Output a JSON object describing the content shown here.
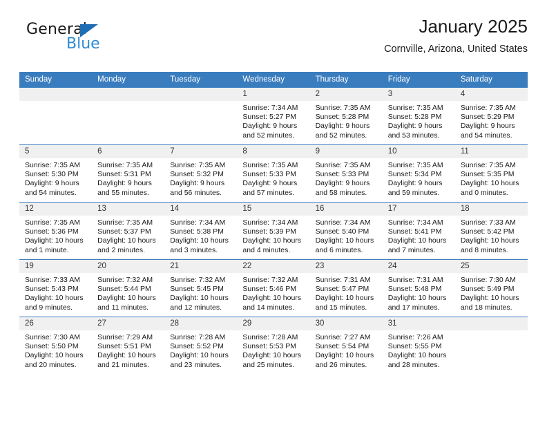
{
  "brand": {
    "name_top": "General",
    "name_bottom": "Blue",
    "accent_color": "#2e8bd4",
    "triangle_color": "#1f6db4"
  },
  "header": {
    "title": "January 2025",
    "subtitle": "Cornville, Arizona, United States"
  },
  "theme": {
    "header_bg": "#3a7dbf",
    "daynum_bg": "#f0f0f0",
    "page_bg": "#ffffff"
  },
  "weekday_headers": [
    "Sunday",
    "Monday",
    "Tuesday",
    "Wednesday",
    "Thursday",
    "Friday",
    "Saturday"
  ],
  "labels": {
    "sunrise_prefix": "Sunrise:",
    "sunset_prefix": "Sunset:",
    "daylight_prefix": "Daylight:"
  },
  "weeks": [
    [
      {
        "day": "",
        "sunrise": "",
        "sunset": "",
        "daylight_line1": "",
        "daylight_line2": ""
      },
      {
        "day": "",
        "sunrise": "",
        "sunset": "",
        "daylight_line1": "",
        "daylight_line2": ""
      },
      {
        "day": "",
        "sunrise": "",
        "sunset": "",
        "daylight_line1": "",
        "daylight_line2": ""
      },
      {
        "day": "1",
        "sunrise": "Sunrise: 7:34 AM",
        "sunset": "Sunset: 5:27 PM",
        "daylight_line1": "Daylight: 9 hours",
        "daylight_line2": "and 52 minutes."
      },
      {
        "day": "2",
        "sunrise": "Sunrise: 7:35 AM",
        "sunset": "Sunset: 5:28 PM",
        "daylight_line1": "Daylight: 9 hours",
        "daylight_line2": "and 52 minutes."
      },
      {
        "day": "3",
        "sunrise": "Sunrise: 7:35 AM",
        "sunset": "Sunset: 5:28 PM",
        "daylight_line1": "Daylight: 9 hours",
        "daylight_line2": "and 53 minutes."
      },
      {
        "day": "4",
        "sunrise": "Sunrise: 7:35 AM",
        "sunset": "Sunset: 5:29 PM",
        "daylight_line1": "Daylight: 9 hours",
        "daylight_line2": "and 54 minutes."
      }
    ],
    [
      {
        "day": "5",
        "sunrise": "Sunrise: 7:35 AM",
        "sunset": "Sunset: 5:30 PM",
        "daylight_line1": "Daylight: 9 hours",
        "daylight_line2": "and 54 minutes."
      },
      {
        "day": "6",
        "sunrise": "Sunrise: 7:35 AM",
        "sunset": "Sunset: 5:31 PM",
        "daylight_line1": "Daylight: 9 hours",
        "daylight_line2": "and 55 minutes."
      },
      {
        "day": "7",
        "sunrise": "Sunrise: 7:35 AM",
        "sunset": "Sunset: 5:32 PM",
        "daylight_line1": "Daylight: 9 hours",
        "daylight_line2": "and 56 minutes."
      },
      {
        "day": "8",
        "sunrise": "Sunrise: 7:35 AM",
        "sunset": "Sunset: 5:33 PM",
        "daylight_line1": "Daylight: 9 hours",
        "daylight_line2": "and 57 minutes."
      },
      {
        "day": "9",
        "sunrise": "Sunrise: 7:35 AM",
        "sunset": "Sunset: 5:33 PM",
        "daylight_line1": "Daylight: 9 hours",
        "daylight_line2": "and 58 minutes."
      },
      {
        "day": "10",
        "sunrise": "Sunrise: 7:35 AM",
        "sunset": "Sunset: 5:34 PM",
        "daylight_line1": "Daylight: 9 hours",
        "daylight_line2": "and 59 minutes."
      },
      {
        "day": "11",
        "sunrise": "Sunrise: 7:35 AM",
        "sunset": "Sunset: 5:35 PM",
        "daylight_line1": "Daylight: 10 hours",
        "daylight_line2": "and 0 minutes."
      }
    ],
    [
      {
        "day": "12",
        "sunrise": "Sunrise: 7:35 AM",
        "sunset": "Sunset: 5:36 PM",
        "daylight_line1": "Daylight: 10 hours",
        "daylight_line2": "and 1 minute."
      },
      {
        "day": "13",
        "sunrise": "Sunrise: 7:35 AM",
        "sunset": "Sunset: 5:37 PM",
        "daylight_line1": "Daylight: 10 hours",
        "daylight_line2": "and 2 minutes."
      },
      {
        "day": "14",
        "sunrise": "Sunrise: 7:34 AM",
        "sunset": "Sunset: 5:38 PM",
        "daylight_line1": "Daylight: 10 hours",
        "daylight_line2": "and 3 minutes."
      },
      {
        "day": "15",
        "sunrise": "Sunrise: 7:34 AM",
        "sunset": "Sunset: 5:39 PM",
        "daylight_line1": "Daylight: 10 hours",
        "daylight_line2": "and 4 minutes."
      },
      {
        "day": "16",
        "sunrise": "Sunrise: 7:34 AM",
        "sunset": "Sunset: 5:40 PM",
        "daylight_line1": "Daylight: 10 hours",
        "daylight_line2": "and 6 minutes."
      },
      {
        "day": "17",
        "sunrise": "Sunrise: 7:34 AM",
        "sunset": "Sunset: 5:41 PM",
        "daylight_line1": "Daylight: 10 hours",
        "daylight_line2": "and 7 minutes."
      },
      {
        "day": "18",
        "sunrise": "Sunrise: 7:33 AM",
        "sunset": "Sunset: 5:42 PM",
        "daylight_line1": "Daylight: 10 hours",
        "daylight_line2": "and 8 minutes."
      }
    ],
    [
      {
        "day": "19",
        "sunrise": "Sunrise: 7:33 AM",
        "sunset": "Sunset: 5:43 PM",
        "daylight_line1": "Daylight: 10 hours",
        "daylight_line2": "and 9 minutes."
      },
      {
        "day": "20",
        "sunrise": "Sunrise: 7:32 AM",
        "sunset": "Sunset: 5:44 PM",
        "daylight_line1": "Daylight: 10 hours",
        "daylight_line2": "and 11 minutes."
      },
      {
        "day": "21",
        "sunrise": "Sunrise: 7:32 AM",
        "sunset": "Sunset: 5:45 PM",
        "daylight_line1": "Daylight: 10 hours",
        "daylight_line2": "and 12 minutes."
      },
      {
        "day": "22",
        "sunrise": "Sunrise: 7:32 AM",
        "sunset": "Sunset: 5:46 PM",
        "daylight_line1": "Daylight: 10 hours",
        "daylight_line2": "and 14 minutes."
      },
      {
        "day": "23",
        "sunrise": "Sunrise: 7:31 AM",
        "sunset": "Sunset: 5:47 PM",
        "daylight_line1": "Daylight: 10 hours",
        "daylight_line2": "and 15 minutes."
      },
      {
        "day": "24",
        "sunrise": "Sunrise: 7:31 AM",
        "sunset": "Sunset: 5:48 PM",
        "daylight_line1": "Daylight: 10 hours",
        "daylight_line2": "and 17 minutes."
      },
      {
        "day": "25",
        "sunrise": "Sunrise: 7:30 AM",
        "sunset": "Sunset: 5:49 PM",
        "daylight_line1": "Daylight: 10 hours",
        "daylight_line2": "and 18 minutes."
      }
    ],
    [
      {
        "day": "26",
        "sunrise": "Sunrise: 7:30 AM",
        "sunset": "Sunset: 5:50 PM",
        "daylight_line1": "Daylight: 10 hours",
        "daylight_line2": "and 20 minutes."
      },
      {
        "day": "27",
        "sunrise": "Sunrise: 7:29 AM",
        "sunset": "Sunset: 5:51 PM",
        "daylight_line1": "Daylight: 10 hours",
        "daylight_line2": "and 21 minutes."
      },
      {
        "day": "28",
        "sunrise": "Sunrise: 7:28 AM",
        "sunset": "Sunset: 5:52 PM",
        "daylight_line1": "Daylight: 10 hours",
        "daylight_line2": "and 23 minutes."
      },
      {
        "day": "29",
        "sunrise": "Sunrise: 7:28 AM",
        "sunset": "Sunset: 5:53 PM",
        "daylight_line1": "Daylight: 10 hours",
        "daylight_line2": "and 25 minutes."
      },
      {
        "day": "30",
        "sunrise": "Sunrise: 7:27 AM",
        "sunset": "Sunset: 5:54 PM",
        "daylight_line1": "Daylight: 10 hours",
        "daylight_line2": "and 26 minutes."
      },
      {
        "day": "31",
        "sunrise": "Sunrise: 7:26 AM",
        "sunset": "Sunset: 5:55 PM",
        "daylight_line1": "Daylight: 10 hours",
        "daylight_line2": "and 28 minutes."
      },
      {
        "day": "",
        "sunrise": "",
        "sunset": "",
        "daylight_line1": "",
        "daylight_line2": ""
      }
    ]
  ]
}
